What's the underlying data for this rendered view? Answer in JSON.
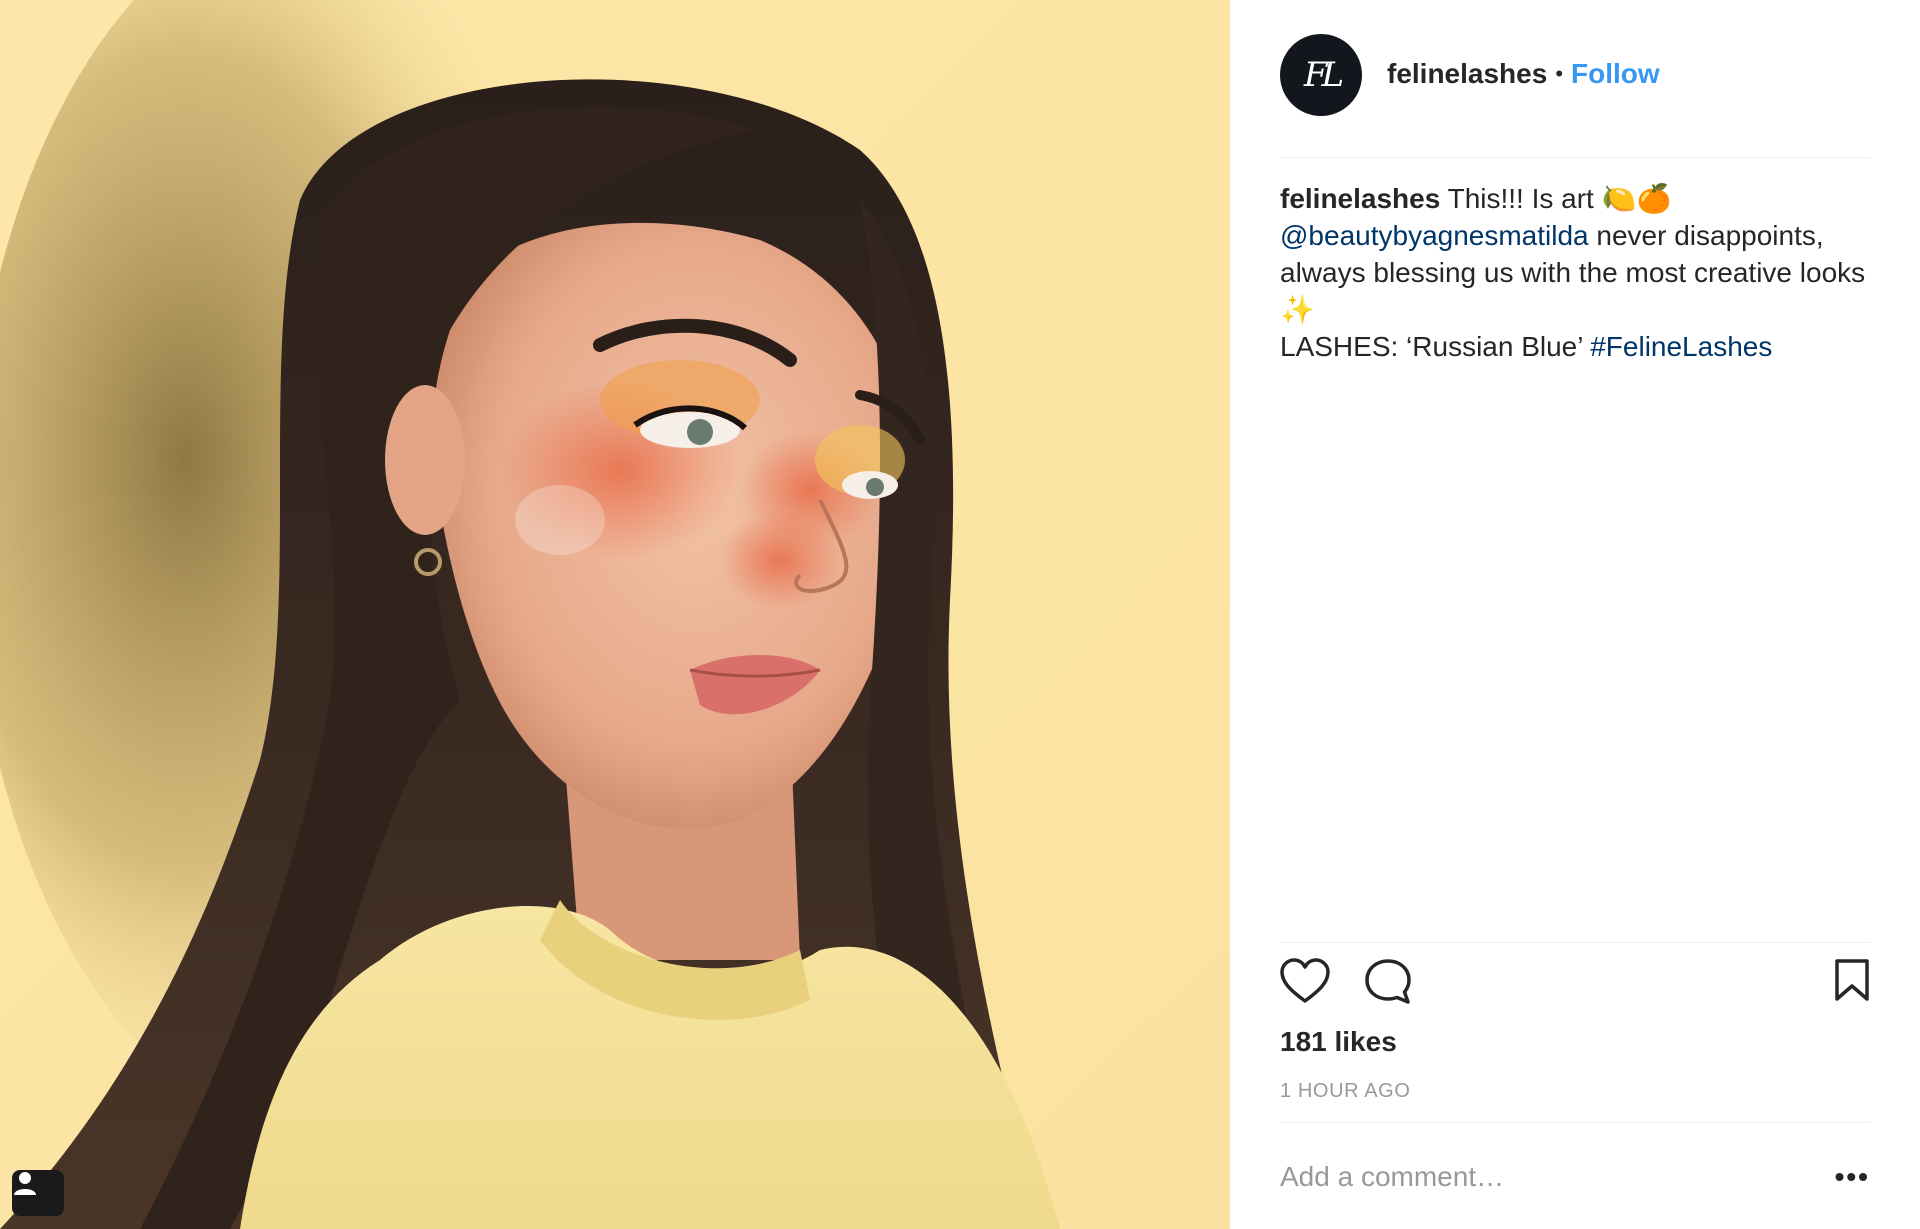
{
  "photo": {
    "background_color": "#fde7a8"
  },
  "header": {
    "avatar_initials": "FL",
    "username": "felinelashes",
    "separator": "•",
    "follow_label": "Follow"
  },
  "caption": {
    "username": "felinelashes",
    "text_1": " This!!! Is art ",
    "emoji_1": "🍋🍊",
    "mention": "@beautybyagnesmatilda",
    "text_2": " never disappoints, always blessing us with the most creative looks ",
    "emoji_2": "✨",
    "text_3": "LASHES: ‘Russian Blue’ ",
    "hashtag": "#FelineLashes"
  },
  "actions": {
    "like_icon": "heart-icon",
    "comment_icon": "comment-icon",
    "save_icon": "bookmark-icon"
  },
  "likes": "181 likes",
  "timestamp": "1 HOUR AGO",
  "comment": {
    "placeholder": "Add a comment…",
    "more_label": "•••"
  },
  "colors": {
    "link": "#003569",
    "follow": "#3897f0",
    "muted": "#999999",
    "text": "#262626"
  }
}
